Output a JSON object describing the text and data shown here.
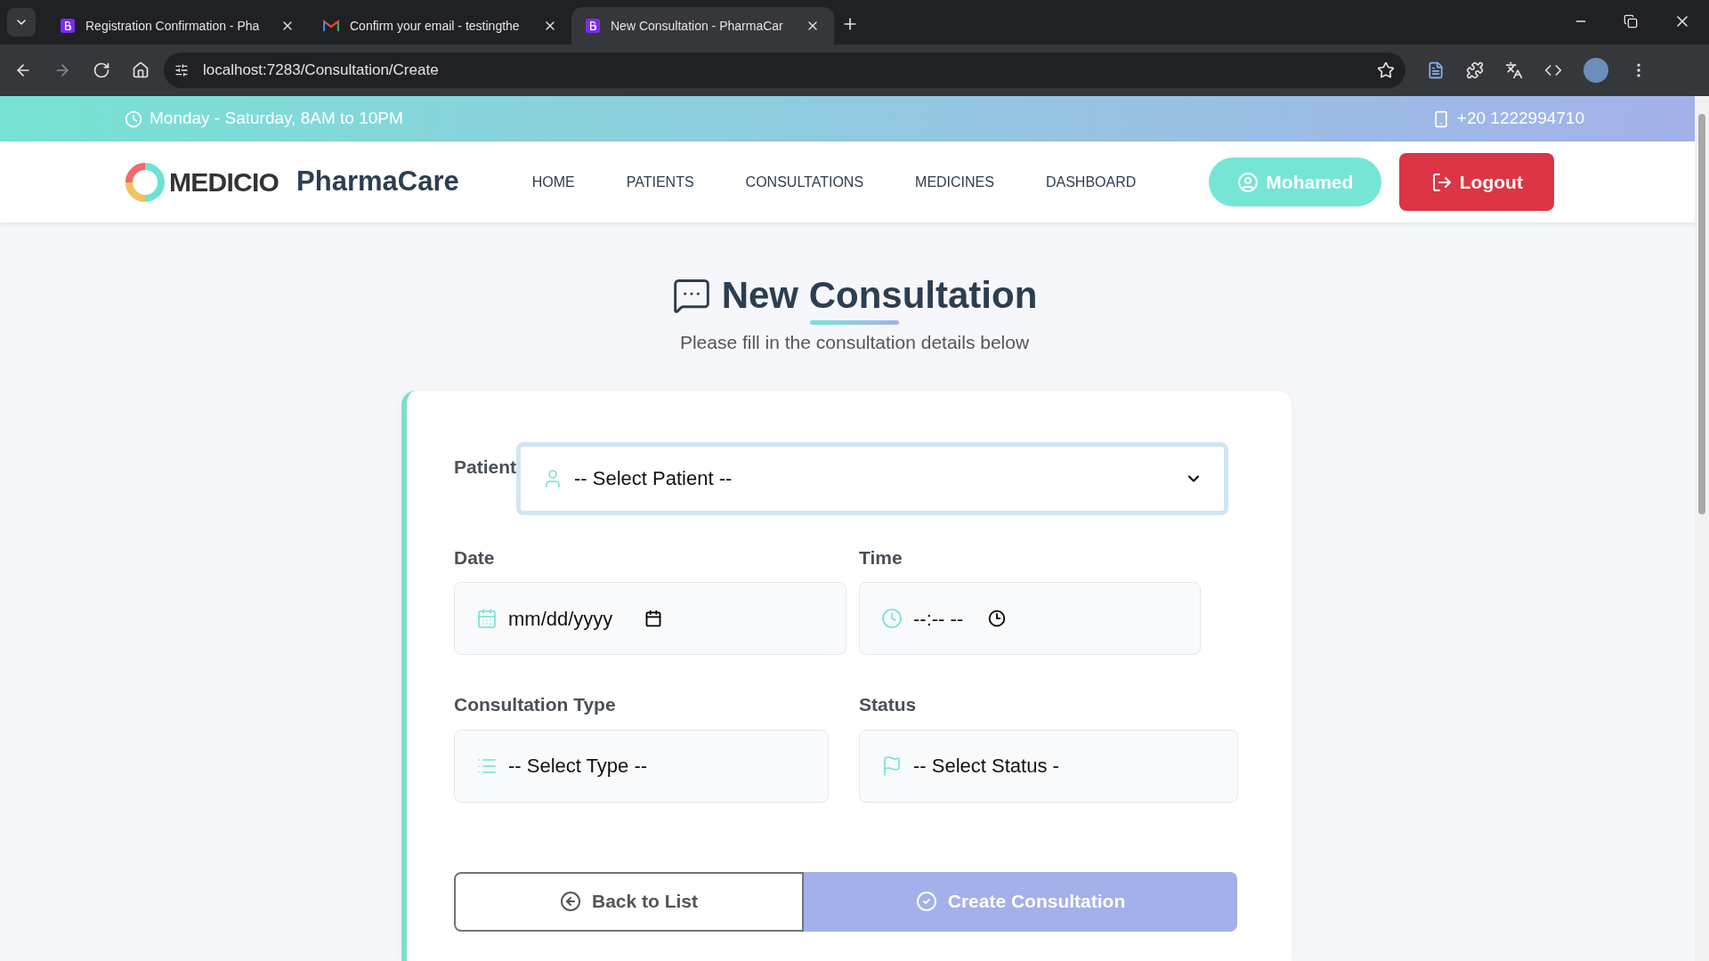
{
  "browser": {
    "tabs": [
      {
        "title": "Registration Confirmation - Pha",
        "selected": false
      },
      {
        "title": "Confirm your email - testingthe",
        "selected": false
      },
      {
        "title": "New Consultation - PharmaCar",
        "selected": true
      }
    ],
    "address": "localhost:7283/Consultation/Create"
  },
  "topbar": {
    "hours": "Monday - Saturday, 8AM to 10PM",
    "phone": "+20 1222994710"
  },
  "navbar": {
    "logo": "MEDICIO",
    "brand": "PharmaCare",
    "links": [
      "HOME",
      "PATIENTS",
      "CONSULTATIONS",
      "MEDICINES",
      "DASHBOARD"
    ],
    "user": "Mohamed",
    "logout": "Logout"
  },
  "page": {
    "title": "New Consultation",
    "subtitle": "Please fill in the consultation details below"
  },
  "form": {
    "fields": [
      {
        "kind": "select",
        "label": "Patient",
        "placeholder": "-- Select Patient --",
        "focused": true
      },
      {
        "kind": "date",
        "label": "Date",
        "placeholder": "mm/dd/yyyy",
        "focused": false
      },
      {
        "kind": "time",
        "label": "Time",
        "placeholder": "--:-- --",
        "focused": false
      },
      {
        "kind": "select",
        "label": "Consultation Type",
        "placeholder": "-- Select Type --",
        "focused": false
      },
      {
        "kind": "select",
        "label": "Status",
        "placeholder": "-- Select Status -",
        "focused": false
      }
    ],
    "buttons": [
      {
        "kind": "secondary",
        "label": "Back to List"
      },
      {
        "kind": "primary",
        "label": "Create Consultation"
      }
    ]
  }
}
